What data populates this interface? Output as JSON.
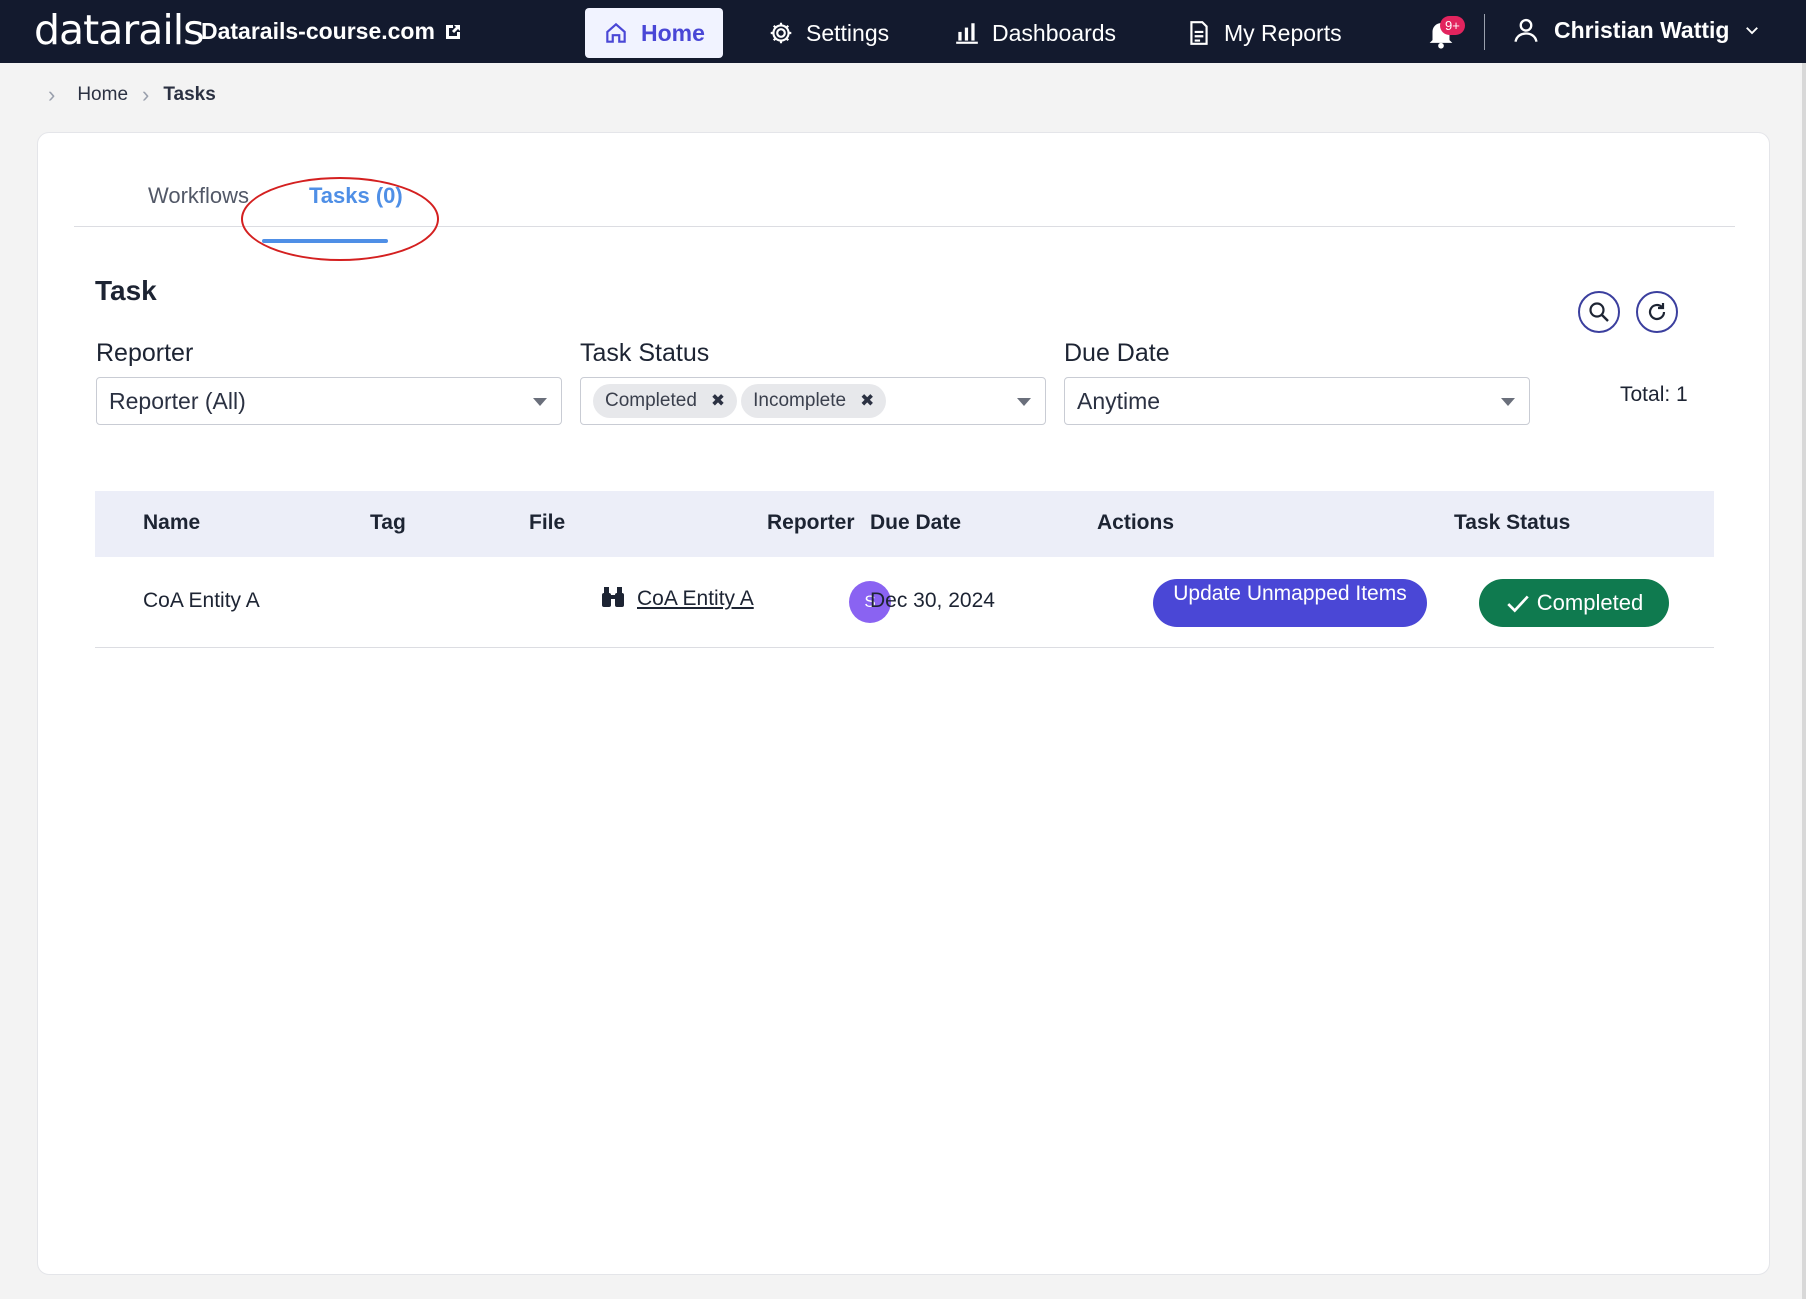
{
  "header": {
    "logo_text": "datarails",
    "domain": "Datarails-course.com",
    "nav": [
      {
        "label": "Home",
        "icon": "home-icon",
        "active": true
      },
      {
        "label": "Settings",
        "icon": "gear-icon"
      },
      {
        "label": "Dashboards",
        "icon": "bar-chart-icon"
      },
      {
        "label": "My Reports",
        "icon": "document-icon"
      }
    ],
    "notifications_badge": "9+",
    "user_name": "Christian Wattig"
  },
  "breadcrumb": {
    "items": [
      "Home",
      "Tasks"
    ]
  },
  "tabs": [
    {
      "label": "Workflows"
    },
    {
      "label": "Tasks (0)",
      "active": true
    }
  ],
  "section_title": "Task",
  "filters": {
    "reporter": {
      "label": "Reporter",
      "value": "Reporter (All)"
    },
    "task_status": {
      "label": "Task Status",
      "chips": [
        "Completed",
        "Incomplete"
      ]
    },
    "due_date": {
      "label": "Due Date",
      "value": "Anytime"
    }
  },
  "total_label": "Total: 1",
  "table": {
    "columns": [
      "Name",
      "Tag",
      "File",
      "Reporter",
      "Due Date",
      "Actions",
      "Task Status"
    ],
    "rows": [
      {
        "name": "CoA Entity A",
        "tag": "",
        "file": "CoA Entity A",
        "reporter_initial": "S",
        "due_date": "Dec 30, 2024",
        "action": "Update Unmapped Items",
        "status": "Completed"
      }
    ]
  },
  "colors": {
    "topbar": "#131a2e",
    "primary": "#4a47d6",
    "tab_active": "#4f8fe6",
    "status_completed": "#0f7a4f",
    "avatar": "#8a63f2",
    "annotation": "#d42020"
  }
}
